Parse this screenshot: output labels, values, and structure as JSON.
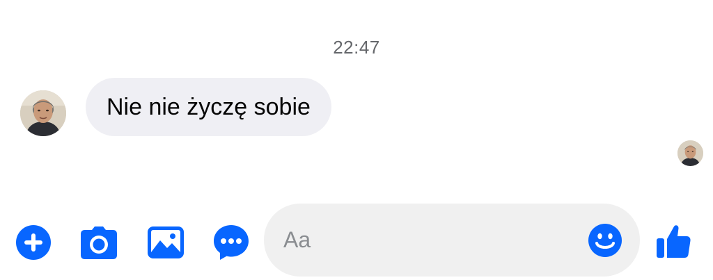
{
  "conversation": {
    "timestamp": "22:47",
    "messages": [
      {
        "text": "Nie nie życzę sobie"
      }
    ]
  },
  "composer": {
    "placeholder": "Aa",
    "value": "",
    "icons": {
      "add": "plus-circle-icon",
      "camera": "camera-icon",
      "gallery": "image-icon",
      "more": "chat-dots-icon",
      "emoji": "smiley-icon",
      "like": "thumbs-up-icon"
    }
  },
  "colors": {
    "accent": "#0866ff",
    "bubble_bg": "#efeff4",
    "composer_bg": "#f0f0f0",
    "timestamp": "#65676b",
    "text": "#050505"
  }
}
